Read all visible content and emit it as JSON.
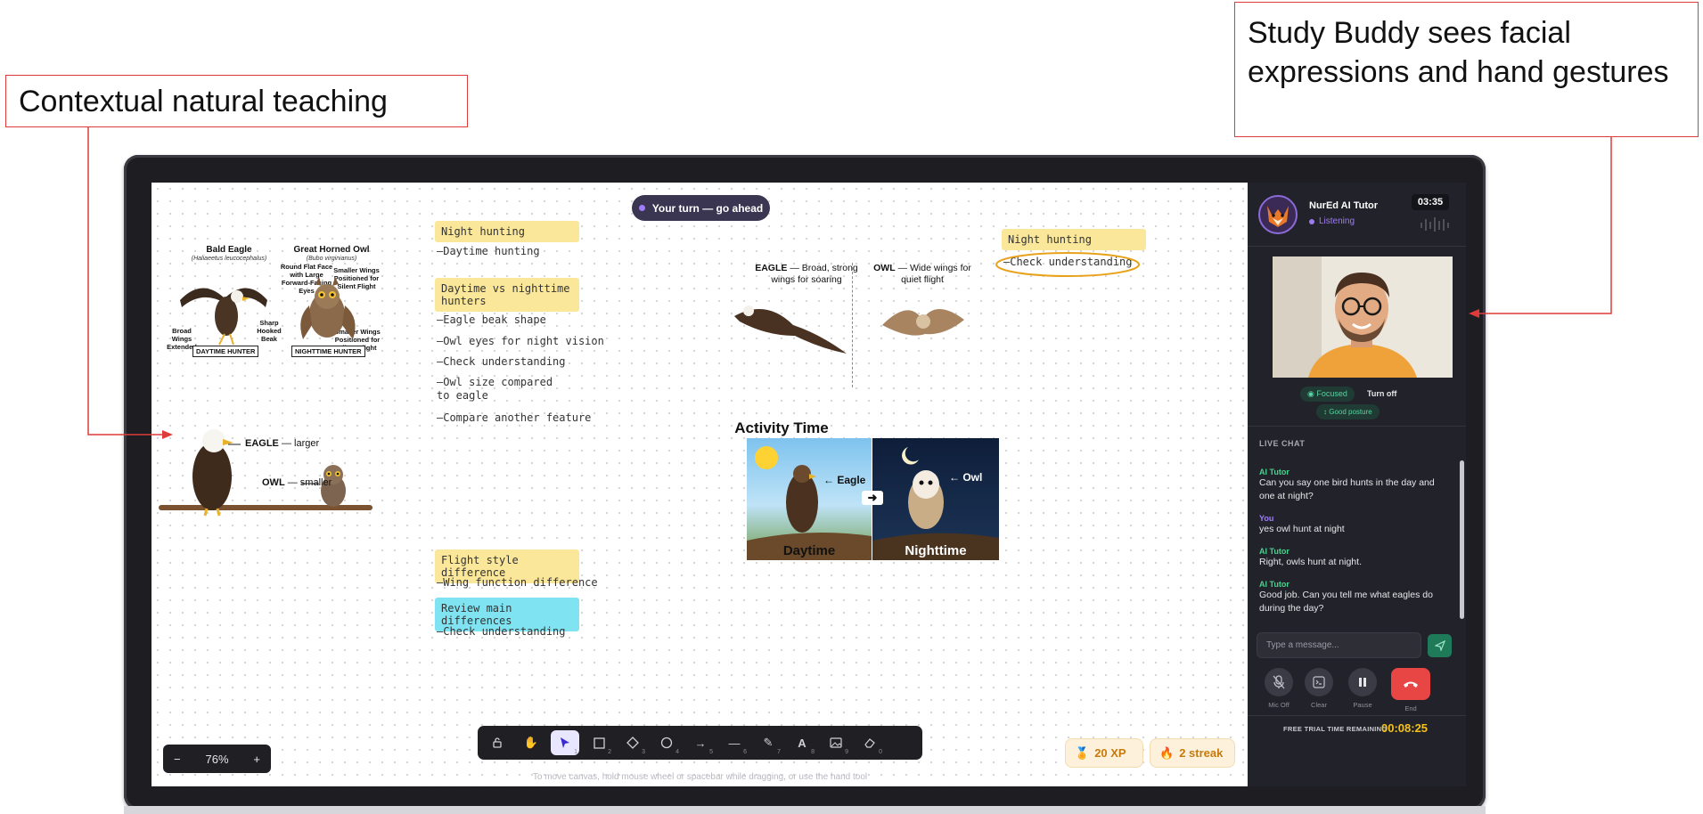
{
  "callouts": {
    "left": "Contextual natural teaching",
    "right": "Study Buddy sees facial expressions and hand gestures"
  },
  "canvas": {
    "turn_pill": "Your turn — go ahead",
    "diagram1": {
      "eagle_title": "Bald Eagle",
      "eagle_latin": "(Haliaeetus leucocephalus)",
      "owl_title": "Great Horned Owl",
      "owl_latin": "(Bubo virginianus)",
      "ann_round_face": "Round Flat Face with Large Forward-Facing Eyes",
      "ann_smaller_wings": "Smaller Wings Positioned for Silent Flight",
      "ann_broad_wings": "Broad Wings Extended",
      "ann_sharp_beak": "Sharp Hooked Beak",
      "ann_smaller_wings_2": "Smaller Wings Positioned for Silent Flight",
      "tag_day": "DAYTIME HUNTER",
      "tag_night": "NIGHTTIME HUNTER"
    },
    "diagram2": {
      "eagle_label": "EAGLE",
      "eagle_desc": "— larger",
      "owl_label": "OWL",
      "owl_desc": "— smaller"
    },
    "notes_col1": {
      "h1": "Night hunting",
      "n1": "—Daytime hunting",
      "h2": "Daytime vs nighttime hunters",
      "n2": "—Eagle beak shape",
      "n3": "—Owl eyes for night vision",
      "n4": "—Check understanding",
      "n5": "—Owl size compared to eagle",
      "n6": "—Compare another feature",
      "h3": "Flight style difference",
      "n7": "—Wing function difference",
      "h4": "Review main differences",
      "n8": "—Check understanding"
    },
    "notes_col2": {
      "h1": "Night hunting",
      "n1": "—Check understanding"
    },
    "flight": {
      "eagle_label": "EAGLE",
      "eagle_desc": "— Broad, strong wings for soaring",
      "owl_label": "OWL",
      "owl_desc": "— Wide wings for quiet flight"
    },
    "activity": {
      "title": "Activity Time",
      "eagle_ptr": "Eagle",
      "owl_ptr": "Owl",
      "day_cap": "Daytime",
      "night_cap": "Nighttime"
    },
    "zoom": {
      "minus": "−",
      "value": "76%",
      "plus": "+"
    },
    "hint": "To move canvas, hold mouse wheel or spacebar while dragging, or use the hand tool",
    "badges": {
      "xp": "20 XP",
      "streak": "2 streak"
    },
    "tool_numbers": [
      "",
      "",
      "1",
      "2",
      "3",
      "4",
      "5",
      "6",
      "7",
      "8",
      "9",
      "0"
    ]
  },
  "panel": {
    "tutor_name": "NurEd AI Tutor",
    "status": "Listening",
    "timer": "03:35",
    "chips": {
      "focused": "Focused",
      "turn_off": "Turn off",
      "posture": "Good posture"
    },
    "live_chat_title": "LIVE CHAT",
    "messages": [
      {
        "author": "AI Tutor",
        "text": "Can you say one bird hunts in the day and one at night?"
      },
      {
        "author": "You",
        "text": "yes owl hunt at night"
      },
      {
        "author": "AI Tutor",
        "text": "Right, owls hunt at night."
      },
      {
        "author": "AI Tutor",
        "text": "Good job. Can you tell me what eagles do during the day?"
      }
    ],
    "input_placeholder": "Type a message...",
    "controls": {
      "mic": "Mic Off",
      "clear": "Clear",
      "pause": "Pause",
      "end": "End"
    },
    "trial_label": "FREE TRIAL TIME REMAINING",
    "trial_time": "00:08:25"
  },
  "colors": {
    "accent_purple": "#8b6bd8",
    "highlight_yellow": "#fbe79a",
    "highlight_cyan": "#7fe3f2",
    "end_red": "#e84545",
    "send_green": "#1f7a5a",
    "timer_yellow": "#f3c21b",
    "callout_red": "#e03a3a"
  }
}
